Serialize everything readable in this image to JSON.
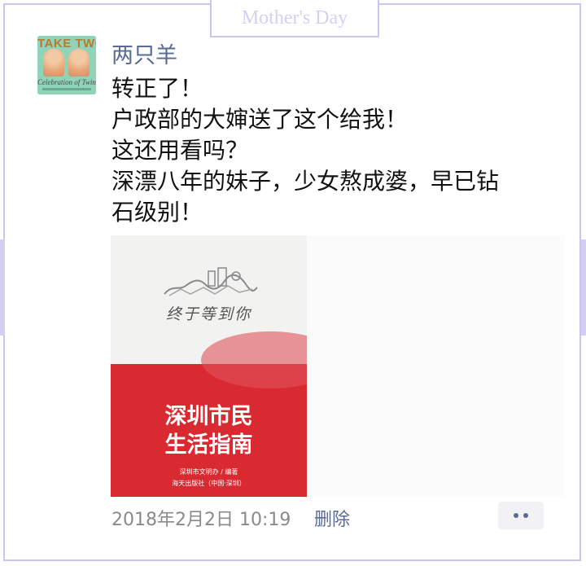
{
  "frame": {
    "tab_label": "Mother's Day"
  },
  "post": {
    "avatar": {
      "title": "TAKE TWO",
      "subtitle": "Celebration of Twins"
    },
    "username": "两只羊",
    "lines": [
      "转正了！",
      "户政部的大婶送了这个给我！",
      "这还用看吗？",
      "深漂八年的妹子，少女熬成婆，早已钻",
      "石级别！"
    ],
    "photo": {
      "slogan": "终于等到你",
      "title_line1": "深圳市民",
      "title_line2": "生活指南",
      "publisher": "深圳市文明办 / 编著",
      "press": "海天出版社（中国·深圳）"
    },
    "timestamp": "2018年2月2日 10:19",
    "delete_label": "删除"
  },
  "colors": {
    "username": "#576b95",
    "frame_border": "#c9c5ee",
    "book_red": "#d92a32"
  }
}
